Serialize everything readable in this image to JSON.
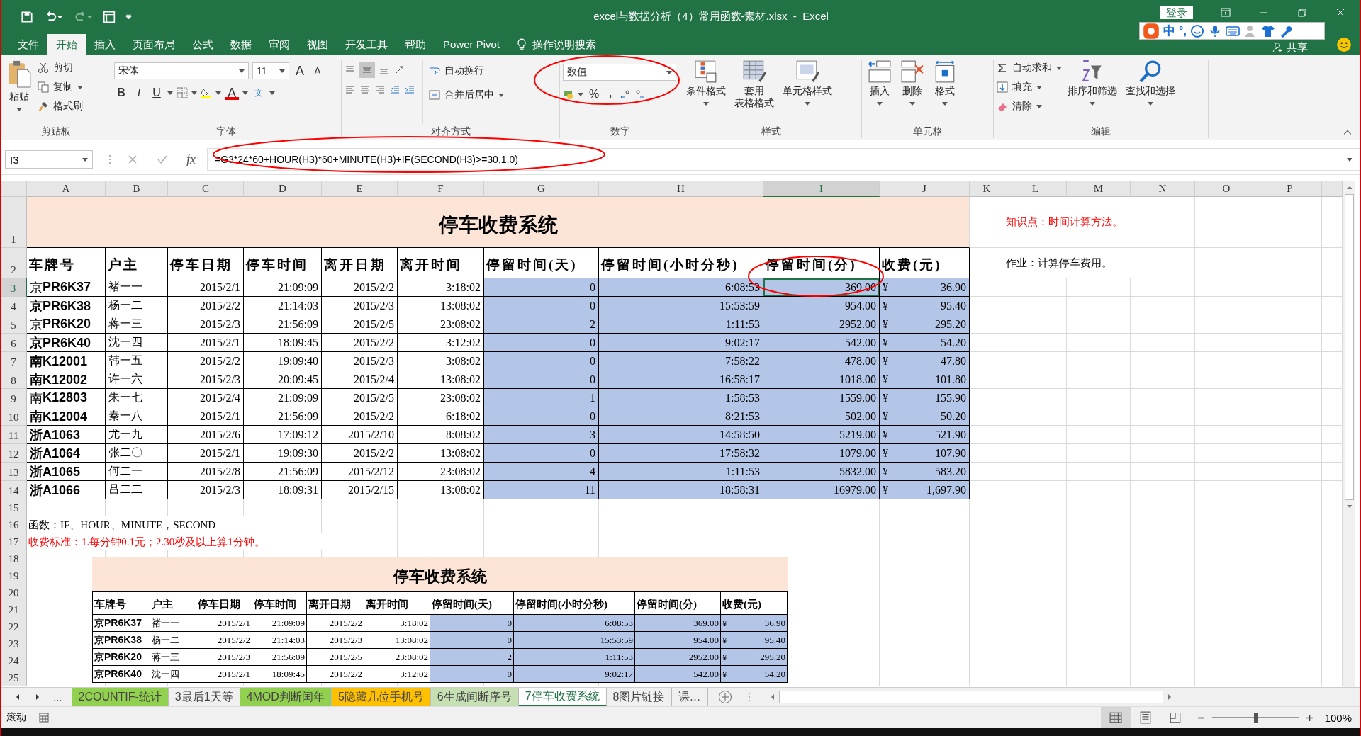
{
  "window": {
    "title": "excel与数据分析（4）常用函数-素材.xlsx  -  Excel",
    "login": "登录",
    "share": "共享"
  },
  "ime_bar": {
    "mode": "中",
    "punctuation": "°,"
  },
  "ribbon_tabs": [
    {
      "label": "文件",
      "selected": false
    },
    {
      "label": "开始",
      "selected": true
    },
    {
      "label": "插入",
      "selected": false
    },
    {
      "label": "页面布局",
      "selected": false
    },
    {
      "label": "公式",
      "selected": false
    },
    {
      "label": "数据",
      "selected": false
    },
    {
      "label": "审阅",
      "selected": false
    },
    {
      "label": "视图",
      "selected": false
    },
    {
      "label": "开发工具",
      "selected": false
    },
    {
      "label": "帮助",
      "selected": false
    },
    {
      "label": "Power Pivot",
      "selected": false
    }
  ],
  "tell_me": "操作说明搜索",
  "ribbon": {
    "clipboard": {
      "paste": "粘贴",
      "cut": "剪切",
      "copy": "复制",
      "format_painter": "格式刷",
      "label": "剪贴板"
    },
    "font": {
      "name": "宋体",
      "size": "11",
      "grow": "A",
      "shrink": "A",
      "bold": "B",
      "italic": "I",
      "underline": "U",
      "font_color": "A",
      "phonetic": "文",
      "label": "字体"
    },
    "alignment": {
      "wrap": "自动换行",
      "merge": "合并后居中",
      "label": "对齐方式"
    },
    "number": {
      "format": "数值",
      "percent": "%",
      "label": "数字"
    },
    "styles": {
      "conditional": "条件格式",
      "table_line1": "套用",
      "table_line2": "表格格式",
      "cell_styles": "单元格样式",
      "label": "样式"
    },
    "cells": {
      "insert": "插入",
      "delete": "删除",
      "format": "格式",
      "label": "单元格"
    },
    "editing": {
      "autosum": "自动求和",
      "fill": "填充",
      "clear": "清除",
      "sort": "排序和筛选",
      "find": "查找和选择",
      "label": "编辑"
    }
  },
  "formula_bar": {
    "name_box": "I3",
    "fx": "fx",
    "formula": "=G3*24*60+HOUR(H3)*60+MINUTE(H3)+IF(SECOND(H3)>=30,1,0)"
  },
  "column_headers": [
    {
      "label": "A",
      "selected": false
    },
    {
      "label": "B",
      "selected": false
    },
    {
      "label": "C",
      "selected": false
    },
    {
      "label": "D",
      "selected": false
    },
    {
      "label": "E",
      "selected": false
    },
    {
      "label": "F",
      "selected": false
    },
    {
      "label": "G",
      "selected": false
    },
    {
      "label": "H",
      "selected": false
    },
    {
      "label": "I",
      "selected": true
    },
    {
      "label": "J",
      "selected": false
    },
    {
      "label": "K",
      "selected": false
    },
    {
      "label": "L",
      "selected": false
    },
    {
      "label": "M",
      "selected": false
    },
    {
      "label": "N",
      "selected": false
    },
    {
      "label": "O",
      "selected": false
    },
    {
      "label": "P",
      "selected": false
    }
  ],
  "row_headers": [
    {
      "label": "1",
      "selected": false
    },
    {
      "label": "2",
      "selected": false
    },
    {
      "label": "3",
      "selected": true
    },
    {
      "label": "4",
      "selected": false
    },
    {
      "label": "5",
      "selected": false
    },
    {
      "label": "6",
      "selected": false
    },
    {
      "label": "7",
      "selected": false
    },
    {
      "label": "8",
      "selected": false
    },
    {
      "label": "9",
      "selected": false
    },
    {
      "label": "10",
      "selected": false
    },
    {
      "label": "11",
      "selected": false
    },
    {
      "label": "12",
      "selected": false
    },
    {
      "label": "13",
      "selected": false
    },
    {
      "label": "14",
      "selected": false
    },
    {
      "label": "15",
      "selected": false
    },
    {
      "label": "16",
      "selected": false
    },
    {
      "label": "17",
      "selected": false
    },
    {
      "label": "18",
      "selected": false
    },
    {
      "label": "19",
      "selected": false
    },
    {
      "label": "20",
      "selected": false
    },
    {
      "label": "21",
      "selected": false
    },
    {
      "label": "22",
      "selected": false
    },
    {
      "label": "23",
      "selected": false
    },
    {
      "label": "24",
      "selected": false
    },
    {
      "label": "25",
      "selected": false
    }
  ],
  "sheet": {
    "title": "停车收费系统",
    "headers": [
      "车牌号",
      "户主",
      "停车日期",
      "停车时间",
      "离开日期",
      "离开时间",
      "停留时间(天)",
      "停留时间(小时分秒)",
      "停留时间(分)",
      "收费(元)"
    ],
    "rows": [
      {
        "plate": "京**PR6K37**",
        "plate_bold": false,
        "cells": [
          "褚一一",
          "2015/2/1",
          "21:09:09",
          "2015/2/2",
          "3:18:02",
          "0",
          "6:08:53",
          "369.00"
        ],
        "currency": "¥",
        "fee": "36.90"
      },
      {
        "plate": "京PR6K38",
        "plate_bold": true,
        "cells": [
          "杨一二",
          "2015/2/2",
          "21:14:03",
          "2015/2/3",
          "13:08:02",
          "0",
          "15:53:59",
          "954.00"
        ],
        "currency": "¥",
        "fee": "95.40"
      },
      {
        "plate": "京**PR6K20**",
        "plate_bold": false,
        "cells": [
          "蒋一三",
          "2015/2/3",
          "21:56:09",
          "2015/2/5",
          "23:08:02",
          "2",
          "1:11:53",
          "2952.00"
        ],
        "currency": "¥",
        "fee": "295.20"
      },
      {
        "plate": "京PR6K40",
        "plate_bold": true,
        "cells": [
          "沈一四",
          "2015/2/1",
          "18:09:45",
          "2015/2/2",
          "3:12:02",
          "0",
          "9:02:17",
          "542.00"
        ],
        "currency": "¥",
        "fee": "54.20"
      },
      {
        "plate": "南K12001",
        "plate_bold": true,
        "cells": [
          "韩一五",
          "2015/2/2",
          "19:09:40",
          "2015/2/3",
          "3:08:02",
          "0",
          "7:58:22",
          "478.00"
        ],
        "currency": "¥",
        "fee": "47.80"
      },
      {
        "plate": "南K12002",
        "plate_bold": true,
        "cells": [
          "许一六",
          "2015/2/3",
          "20:09:45",
          "2015/2/4",
          "13:08:02",
          "0",
          "16:58:17",
          "1018.00"
        ],
        "currency": "¥",
        "fee": "101.80"
      },
      {
        "plate": "南**K12803**",
        "plate_bold": false,
        "cells": [
          "朱一七",
          "2015/2/4",
          "21:09:09",
          "2015/2/5",
          "23:08:02",
          "1",
          "1:58:53",
          "1559.00"
        ],
        "currency": "¥",
        "fee": "155.90"
      },
      {
        "plate": "南K12004",
        "plate_bold": true,
        "cells": [
          "秦一八",
          "2015/2/1",
          "21:56:09",
          "2015/2/2",
          "6:18:02",
          "0",
          "8:21:53",
          "502.00"
        ],
        "currency": "¥",
        "fee": "50.20"
      },
      {
        "plate": "浙A1063",
        "plate_bold": true,
        "cells": [
          "尤一九",
          "2015/2/6",
          "17:09:12",
          "2015/2/10",
          "8:08:02",
          "3",
          "14:58:50",
          "5219.00"
        ],
        "currency": "¥",
        "fee": "521.90"
      },
      {
        "plate": "浙A1064",
        "plate_bold": true,
        "cells": [
          "张二〇",
          "2015/2/1",
          "19:09:30",
          "2015/2/2",
          "13:08:02",
          "0",
          "17:58:32",
          "1079.00"
        ],
        "currency": "¥",
        "fee": "107.90"
      },
      {
        "plate": "浙A1065",
        "plate_bold": true,
        "cells": [
          "何二一",
          "2015/2/8",
          "21:56:09",
          "2015/2/12",
          "23:08:02",
          "4",
          "1:11:53",
          "5832.00"
        ],
        "currency": "¥",
        "fee": "583.20"
      },
      {
        "plate": "浙A1066",
        "plate_bold": true,
        "cells": [
          "吕二二",
          "2015/2/3",
          "18:09:31",
          "2015/2/15",
          "13:08:02",
          "11",
          "18:58:31",
          "16979.00"
        ],
        "currency": "¥",
        "fee": "1,697.90"
      }
    ],
    "notes": [
      {
        "text": "知识点：时间计算方法。",
        "color": "#ff0000"
      },
      {
        "text": "作业：计算停车费用。",
        "color": "#000000"
      },
      {
        "text": "函数：IF、HOUR、MINUTE，SECOND",
        "color": "#000000"
      },
      {
        "text": "收费标准：1.每分钟0.1元；2.30秒及以上算1分钟。",
        "color": "#ff0000"
      }
    ]
  },
  "picture_table": {
    "title": "停车收费系统",
    "headers": [
      "车牌号",
      "户主",
      "停车日期",
      "停车时间",
      "离开日期",
      "离开时间",
      "停留时间(天)",
      "停留时间(小时分秒)",
      "停留时间(分)",
      "收费(元)"
    ],
    "rows": [
      {
        "plate": "京PR6K37",
        "cells": [
          "褚一一",
          "2015/2/1",
          "21:09:09",
          "2015/2/2",
          "3:18:02",
          "0",
          "6:08:53",
          "369.00"
        ],
        "currency": "¥",
        "fee": "36.90"
      },
      {
        "plate": "京PR6K38",
        "cells": [
          "杨一二",
          "2015/2/2",
          "21:14:03",
          "2015/2/3",
          "13:08:02",
          "0",
          "15:53:59",
          "954.00"
        ],
        "currency": "¥",
        "fee": "95.40"
      },
      {
        "plate": "京PR6K20",
        "cells": [
          "蒋一三",
          "2015/2/3",
          "21:56:09",
          "2015/2/5",
          "23:08:02",
          "2",
          "1:11:53",
          "2952.00"
        ],
        "currency": "¥",
        "fee": "295.20"
      },
      {
        "plate": "京PR6K40",
        "cells": [
          "沈一四",
          "2015/2/1",
          "18:09:45",
          "2015/2/2",
          "3:12:02",
          "0",
          "9:02:17",
          "542.00"
        ],
        "currency": "¥",
        "fee": "54.20"
      }
    ]
  },
  "sheet_tabs": [
    {
      "label": "2COUNTIF-统计",
      "selected": false,
      "color": "#92d050"
    },
    {
      "label": "3最后1天等",
      "selected": false
    },
    {
      "label": "4MOD判断闰年",
      "selected": false,
      "color": "#92d050"
    },
    {
      "label": "5隐藏几位手机号",
      "selected": false,
      "color": "#ffc000"
    },
    {
      "label": "6生成间断序号",
      "selected": false,
      "color": "#c6e0b4"
    },
    {
      "label": "7停车收费系统",
      "selected": true
    },
    {
      "label": "8图片链接",
      "selected": false
    },
    {
      "label": "课…",
      "selected": false
    }
  ],
  "sheet_nav": {
    "more": "..."
  },
  "status_bar": {
    "mode": "滚动",
    "zoom": "100%",
    "zoom_slider": {
      "level": 0.5
    }
  }
}
